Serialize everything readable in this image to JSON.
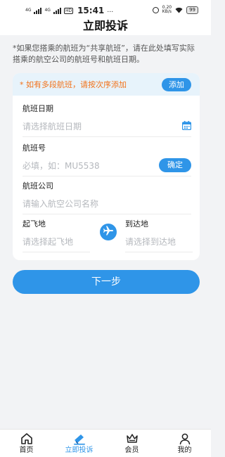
{
  "status_bar": {
    "signal1": "4G",
    "signal2": "4G",
    "hd": "HD",
    "time": "15:41",
    "more": "…",
    "speed_value": "0.20",
    "speed_unit": "KB/s",
    "battery": "99"
  },
  "header": {
    "title": "立即投诉"
  },
  "notice": {
    "text": "*如果您搭乘的航班为“共享航班”，请在此处填写实际搭乘的航空公司的航班号和航班日期。"
  },
  "form": {
    "banner_text": "* 如有多段航班，请按次序添加",
    "add_label": "添加",
    "flight_date": {
      "label": "航班日期",
      "placeholder": "请选择航班日期"
    },
    "flight_no": {
      "label": "航班号",
      "placeholder": "必填，如：MU5538",
      "confirm_label": "确定"
    },
    "airline": {
      "label": "航班公司",
      "placeholder": "请输入航空公司名称"
    },
    "origin": {
      "label": "起飞地",
      "placeholder": "请选择起飞地"
    },
    "destination": {
      "label": "到达地",
      "placeholder": "请选择到达地"
    }
  },
  "next_label": "下一步",
  "nav": {
    "items": [
      {
        "label": "首页",
        "icon": "home-icon"
      },
      {
        "label": "立即投诉",
        "icon": "complaint-icon"
      },
      {
        "label": "会员",
        "icon": "crown-icon"
      },
      {
        "label": "我的",
        "icon": "user-icon"
      }
    ],
    "active_index": 1
  },
  "colors": {
    "accent": "#2f95e8",
    "warning": "#f2731b",
    "banner_bg": "#e7f3fb"
  }
}
